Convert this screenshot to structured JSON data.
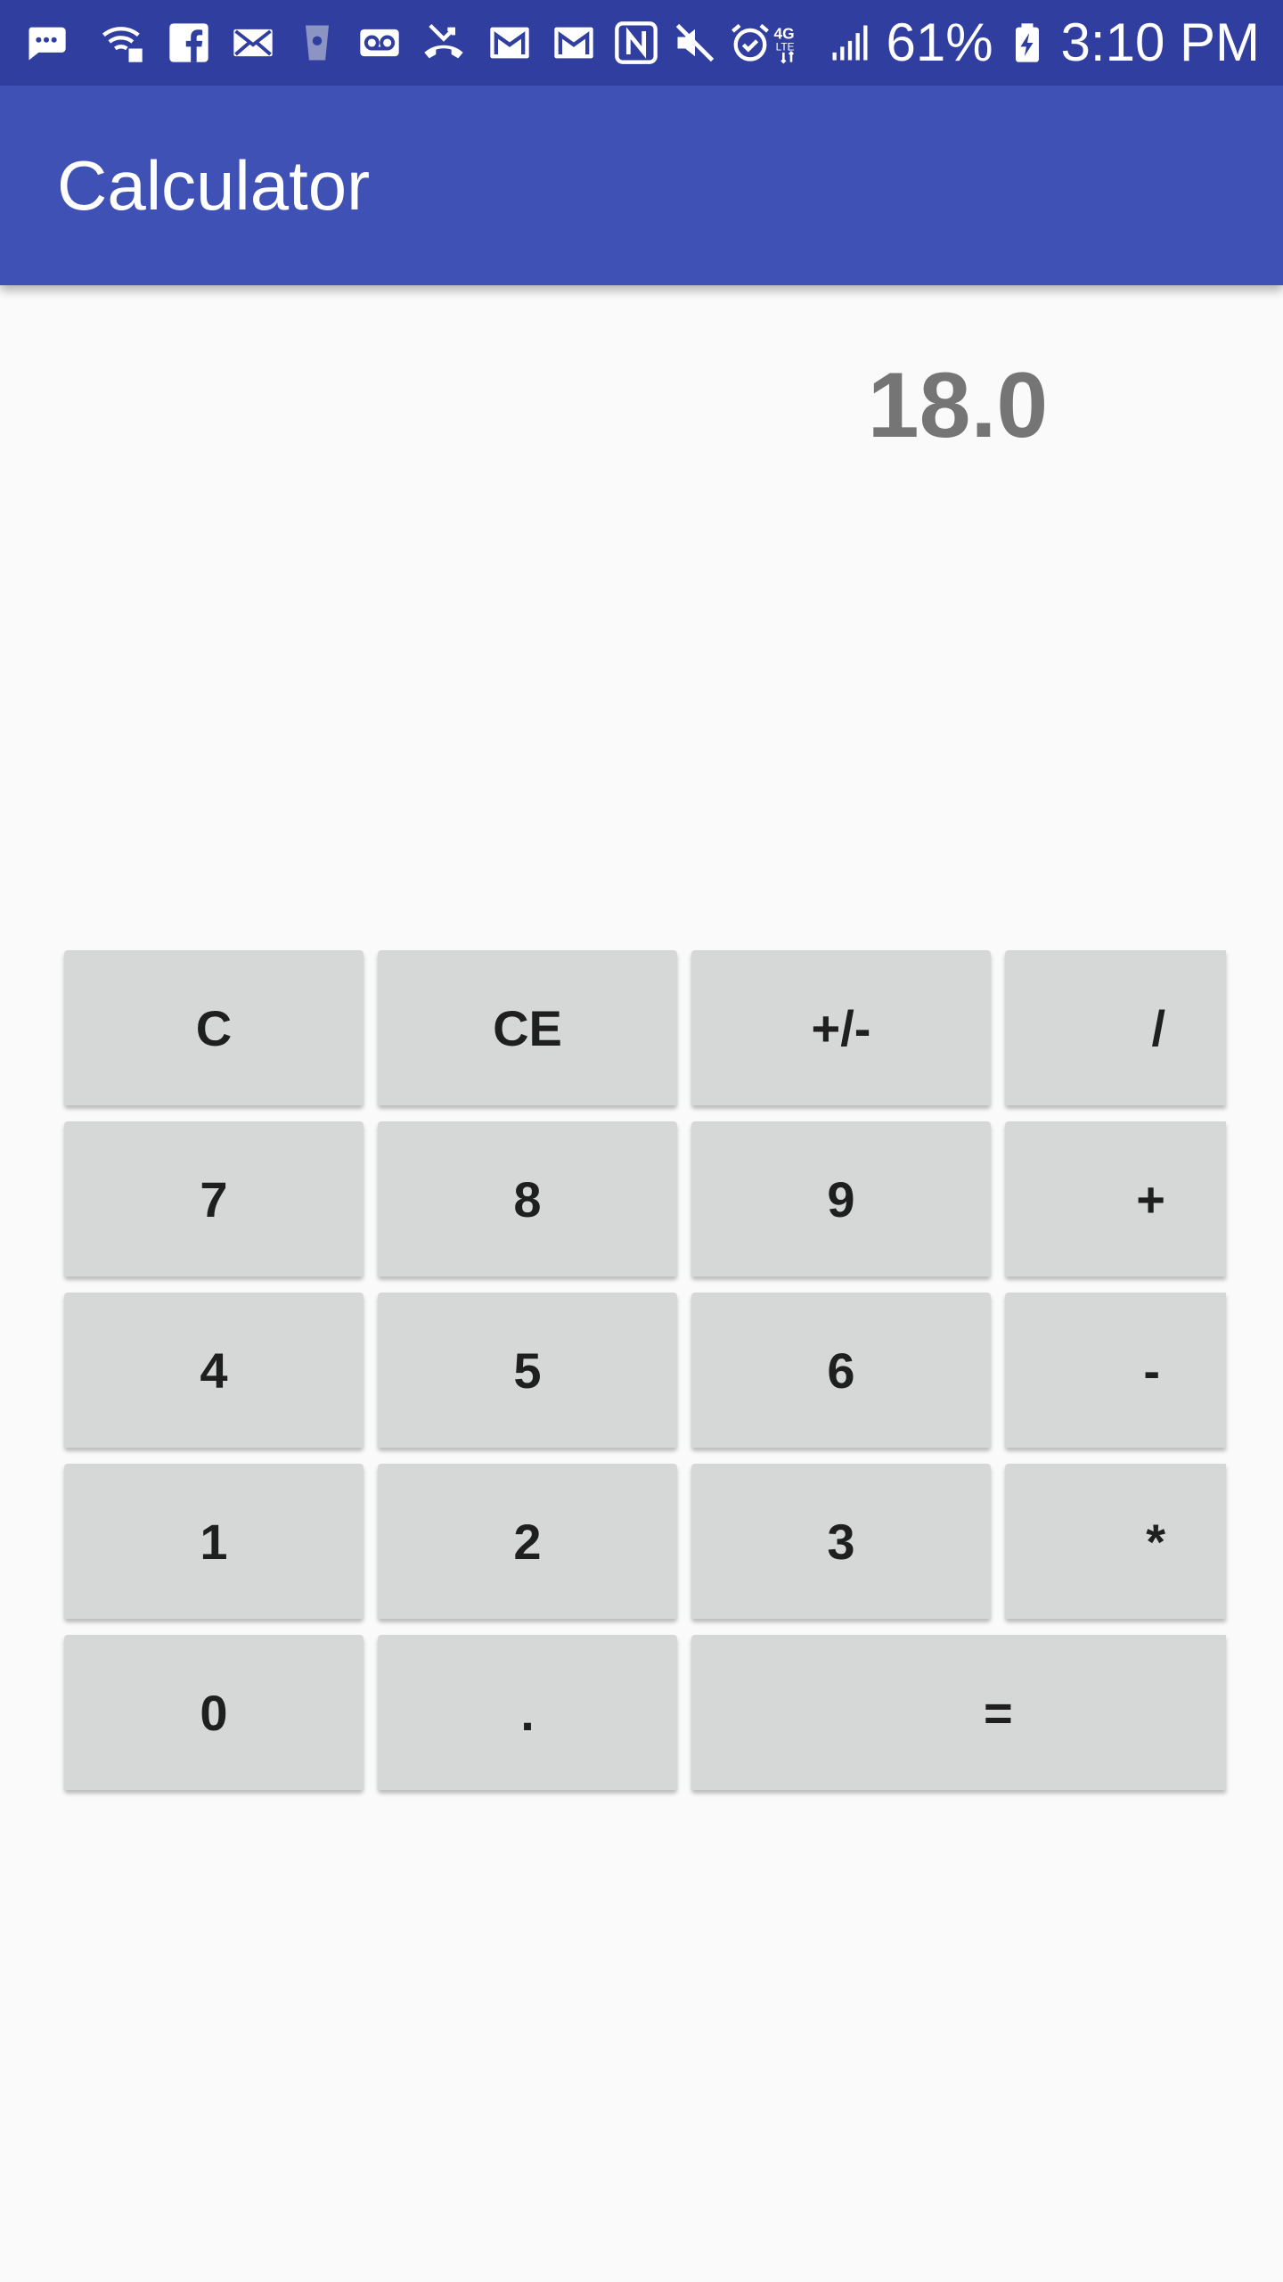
{
  "status_bar": {
    "battery_percent": "61%",
    "time": "3:10 PM",
    "left_icons": [
      "messages-icon",
      "wifi-calling-icon",
      "facebook-icon",
      "email-icon",
      "cup-icon",
      "voicemail-icon",
      "missed-call-icon",
      "gmail-icon",
      "gmail-icon-2",
      "nfc-icon",
      "mute-icon",
      "alarm-icon",
      "lte-icon",
      "signal-icon",
      "battery-charging-icon"
    ]
  },
  "app_bar": {
    "title": "Calculator"
  },
  "display": {
    "value": "18.0"
  },
  "keypad": {
    "rows": [
      [
        "C",
        "CE",
        "+/-",
        "/"
      ],
      [
        "7",
        "8",
        "9",
        "+"
      ],
      [
        "4",
        "5",
        "6",
        "-"
      ],
      [
        "1",
        "2",
        "3",
        "*"
      ],
      [
        "0",
        ".",
        "="
      ]
    ]
  },
  "colors": {
    "status_bar": "#303f9f",
    "app_bar": "#3f51b5",
    "background": "#fafafa",
    "key_background": "#d6d7d7",
    "key_text": "#1f1f1f",
    "display_text": "#757575"
  }
}
